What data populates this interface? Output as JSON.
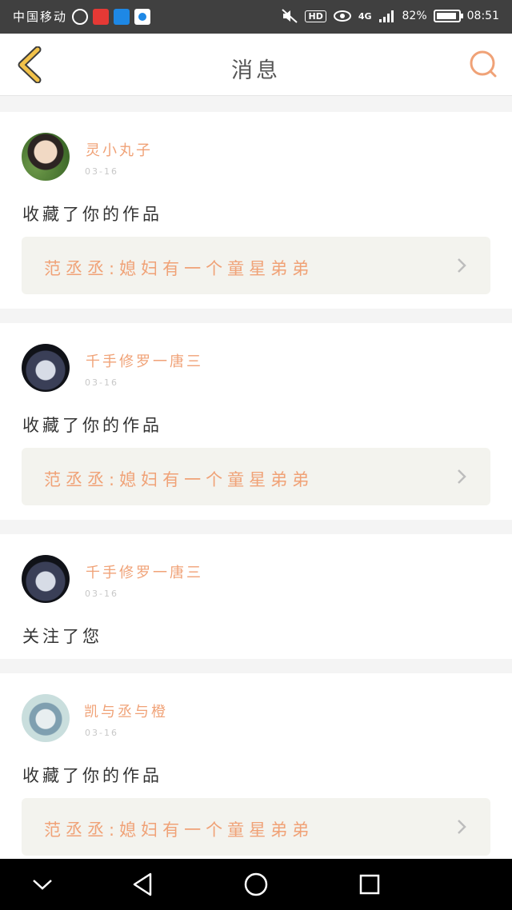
{
  "status_bar": {
    "carrier": "中国移动",
    "battery": "82%",
    "time": "08:51",
    "network": "4G",
    "hd": "HD"
  },
  "header": {
    "title": "消息",
    "back_icon": "chevron-left-icon",
    "search_icon": "search-icon"
  },
  "messages": [
    {
      "user": "灵小丸子",
      "date": "03-16",
      "action": "收藏了你的作品",
      "work": "范丞丞:媳妇有一个童星弟弟"
    },
    {
      "user": "千手修罗一唐三",
      "date": "03-16",
      "action": "收藏了你的作品",
      "work": "范丞丞:媳妇有一个童星弟弟"
    },
    {
      "user": "千手修罗一唐三",
      "date": "03-16",
      "action": "关注了您"
    },
    {
      "user": "凯与丞与橙",
      "date": "03-16",
      "action": "收藏了你的作品",
      "work": "范丞丞:媳妇有一个童星弟弟"
    }
  ],
  "nav_bar": {
    "icons": [
      "chevron-down-icon",
      "back-triangle-icon",
      "home-circle-icon",
      "recents-square-icon"
    ]
  },
  "colors": {
    "accent": "#f0a277",
    "back_icon": "#f2c24a"
  }
}
